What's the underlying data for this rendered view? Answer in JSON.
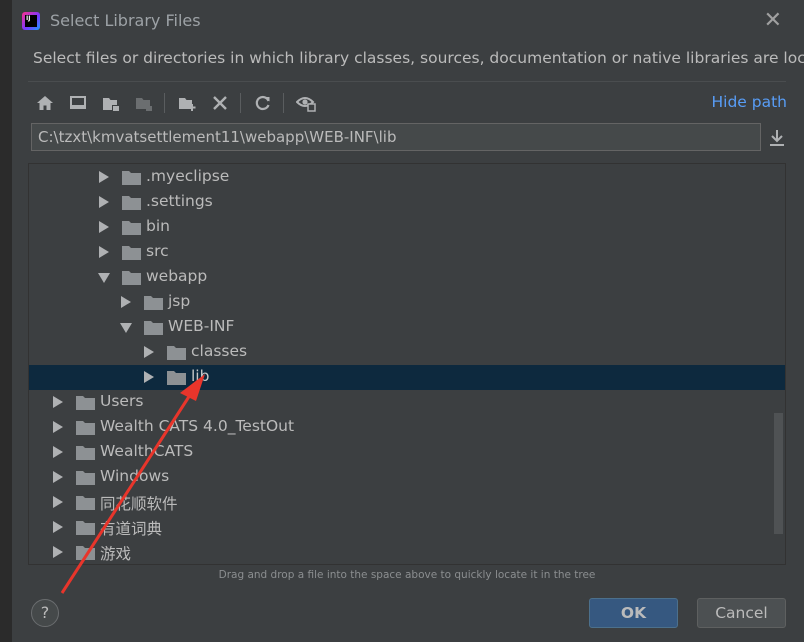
{
  "window": {
    "title": "Select Library Files",
    "app_icon_text": "IJ",
    "close_glyph": "✕"
  },
  "description": "Select files or directories in which library classes, sources, documentation or native libraries are located",
  "toolbar": {
    "icons": [
      "home-icon",
      "desktop-icon",
      "project-folder-icon",
      "module-folder-icon",
      "new-folder-icon",
      "delete-icon",
      "refresh-icon",
      "show-hidden-icon"
    ],
    "hide_path_label": "Hide path"
  },
  "path": {
    "value": "C:\\tzxt\\kmvatsettlement11\\webapp\\WEB-INF\\lib"
  },
  "tree": {
    "items": [
      {
        "label": ".myeclipse",
        "level": 3,
        "expanded": false,
        "selected": false
      },
      {
        "label": ".settings",
        "level": 3,
        "expanded": false,
        "selected": false
      },
      {
        "label": "bin",
        "level": 3,
        "expanded": false,
        "selected": false
      },
      {
        "label": "src",
        "level": 3,
        "expanded": false,
        "selected": false
      },
      {
        "label": "webapp",
        "level": 3,
        "expanded": true,
        "selected": false
      },
      {
        "label": "jsp",
        "level": 4,
        "expanded": false,
        "selected": false
      },
      {
        "label": "WEB-INF",
        "level": 4,
        "expanded": true,
        "selected": false
      },
      {
        "label": "classes",
        "level": 5,
        "expanded": false,
        "selected": false
      },
      {
        "label": "lib",
        "level": 5,
        "expanded": false,
        "selected": true
      },
      {
        "label": "Users",
        "level": 1,
        "expanded": false,
        "selected": false
      },
      {
        "label": "Wealth CATS 4.0_TestOut",
        "level": 1,
        "expanded": false,
        "selected": false
      },
      {
        "label": "WealthCATS",
        "level": 1,
        "expanded": false,
        "selected": false
      },
      {
        "label": "Windows",
        "level": 1,
        "expanded": false,
        "selected": false
      },
      {
        "label": "同花顺软件",
        "level": 1,
        "expanded": false,
        "selected": false
      },
      {
        "label": "有道词典",
        "level": 1,
        "expanded": false,
        "selected": false
      },
      {
        "label": "游戏",
        "level": 1,
        "expanded": false,
        "selected": false
      }
    ]
  },
  "hint": "Drag and drop a file into the space above to quickly locate it in the tree",
  "buttons": {
    "help": "?",
    "ok": "OK",
    "cancel": "Cancel"
  },
  "colors": {
    "background": "#3c3f41",
    "selection": "#0d293e",
    "link": "#589df6",
    "ok_button": "#365880",
    "annotation_arrow": "#e8352b"
  }
}
